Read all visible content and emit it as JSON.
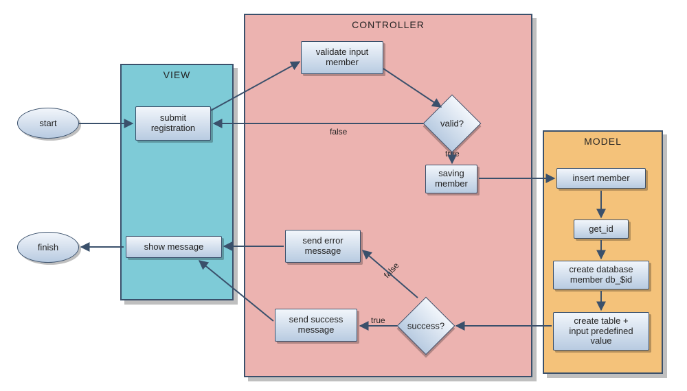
{
  "containers": {
    "view": {
      "title": "VIEW"
    },
    "controller": {
      "title": "CONTROLLER"
    },
    "model": {
      "title": "MODEL"
    }
  },
  "nodes": {
    "start": {
      "label": "start"
    },
    "finish": {
      "label": "finish"
    },
    "submit_reg": {
      "label": "submit\nregistration"
    },
    "show_message": {
      "label": "show message"
    },
    "validate_input": {
      "label": "validate input\nmember"
    },
    "valid_q": {
      "label": "valid?"
    },
    "saving_member": {
      "label": "saving\nmember"
    },
    "send_error": {
      "label": "send error\nmessage"
    },
    "send_success": {
      "label": "send success\nmessage"
    },
    "success_q": {
      "label": "success?"
    },
    "insert_member": {
      "label": "insert member"
    },
    "get_id": {
      "label": "get_id"
    },
    "create_db": {
      "label": "create database\nmember db_$id"
    },
    "create_table": {
      "label": "create table +\ninput predefined\nvalue"
    }
  },
  "edge_labels": {
    "valid_false": "false",
    "valid_true": "true",
    "success_true": "true",
    "success_false": "false"
  },
  "chart_data": {
    "type": "flowchart",
    "groups": {
      "VIEW": [
        "submit_reg",
        "show_message"
      ],
      "CONTROLLER": [
        "validate_input",
        "valid_q",
        "saving_member",
        "send_error",
        "send_success",
        "success_q"
      ],
      "MODEL": [
        "insert_member",
        "get_id",
        "create_db",
        "create_table"
      ]
    },
    "nodes": {
      "start": {
        "label": "start",
        "shape": "ellipse"
      },
      "finish": {
        "label": "finish",
        "shape": "ellipse"
      },
      "submit_reg": {
        "label": "submit registration",
        "shape": "rectangle"
      },
      "show_message": {
        "label": "show message",
        "shape": "rectangle"
      },
      "validate_input": {
        "label": "validate input member",
        "shape": "rectangle"
      },
      "valid_q": {
        "label": "valid?",
        "shape": "diamond"
      },
      "saving_member": {
        "label": "saving member",
        "shape": "rectangle"
      },
      "send_error": {
        "label": "send error message",
        "shape": "rectangle"
      },
      "send_success": {
        "label": "send success message",
        "shape": "rectangle"
      },
      "success_q": {
        "label": "success?",
        "shape": "diamond"
      },
      "insert_member": {
        "label": "insert member",
        "shape": "rectangle"
      },
      "get_id": {
        "label": "get_id",
        "shape": "rectangle"
      },
      "create_db": {
        "label": "create database member db_$id",
        "shape": "rectangle"
      },
      "create_table": {
        "label": "create table + input predefined value",
        "shape": "rectangle"
      }
    },
    "edges": [
      {
        "from": "start",
        "to": "submit_reg"
      },
      {
        "from": "submit_reg",
        "to": "validate_input"
      },
      {
        "from": "validate_input",
        "to": "valid_q"
      },
      {
        "from": "valid_q",
        "to": "submit_reg",
        "label": "false"
      },
      {
        "from": "valid_q",
        "to": "saving_member",
        "label": "true"
      },
      {
        "from": "saving_member",
        "to": "insert_member"
      },
      {
        "from": "insert_member",
        "to": "get_id"
      },
      {
        "from": "get_id",
        "to": "create_db"
      },
      {
        "from": "create_db",
        "to": "create_table"
      },
      {
        "from": "create_table",
        "to": "success_q"
      },
      {
        "from": "success_q",
        "to": "send_success",
        "label": "true"
      },
      {
        "from": "success_q",
        "to": "send_error",
        "label": "false"
      },
      {
        "from": "send_error",
        "to": "show_message"
      },
      {
        "from": "send_success",
        "to": "show_message"
      },
      {
        "from": "show_message",
        "to": "finish"
      }
    ]
  }
}
